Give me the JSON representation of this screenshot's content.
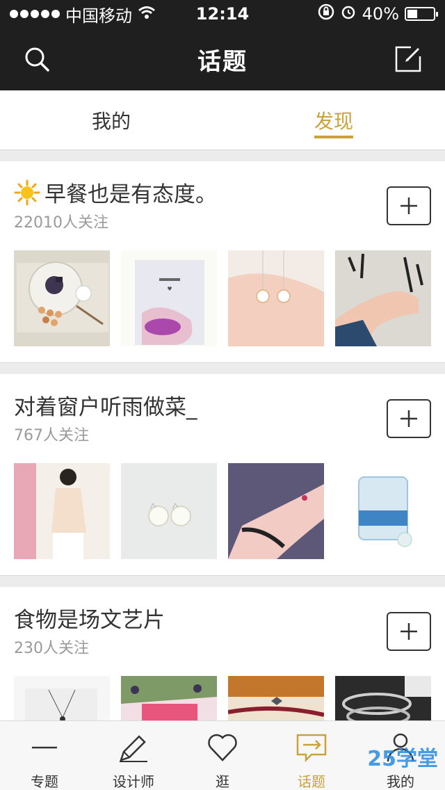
{
  "status": {
    "carrier": "中国移动",
    "time": "12:14",
    "battery": "40%",
    "battery_level": 0.4
  },
  "navbar": {
    "title": "话题"
  },
  "tabs": [
    {
      "label": "我的"
    },
    {
      "label": "发现"
    }
  ],
  "topics": [
    {
      "emoji": "☀",
      "title": "早餐也是有态度。",
      "followers": "22010人关注"
    },
    {
      "title": "对着窗户听雨做菜_",
      "followers": "767人关注"
    },
    {
      "title": "食物是场文艺片",
      "followers": "230人关注"
    }
  ],
  "tabbar": [
    {
      "label": "专题",
      "icon": "dash-icon"
    },
    {
      "label": "设计师",
      "icon": "pencil-icon"
    },
    {
      "label": "逛",
      "icon": "heart-icon"
    },
    {
      "label": "话题",
      "icon": "chat-icon",
      "active": true
    },
    {
      "label": "我的",
      "icon": "person-icon"
    }
  ],
  "watermark": "25学堂",
  "colors": {
    "accent": "#c9a23a",
    "dark": "#1f1f1f"
  }
}
